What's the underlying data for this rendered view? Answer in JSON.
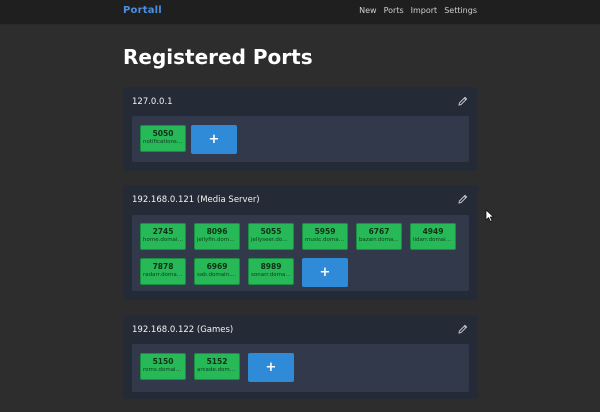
{
  "nav": {
    "brand": "Portall",
    "links": [
      "New",
      "Ports",
      "Import",
      "Settings"
    ]
  },
  "page": {
    "title": "Registered Ports"
  },
  "groups": [
    {
      "title": "127.0.0.1",
      "ports": [
        {
          "number": "5050",
          "domain": "notifications.d..."
        }
      ]
    },
    {
      "title": "192.168.0.121 (Media Server)",
      "ports": [
        {
          "number": "2745",
          "domain": "home.domain...."
        },
        {
          "number": "8096",
          "domain": "jellyfin.domai..."
        },
        {
          "number": "5055",
          "domain": "jellyseer.doma..."
        },
        {
          "number": "5959",
          "domain": "music.domain...."
        },
        {
          "number": "6767",
          "domain": "bazarr.domain...."
        },
        {
          "number": "4949",
          "domain": "lidarr.domain...."
        },
        {
          "number": "7878",
          "domain": "radarr.domain...."
        },
        {
          "number": "6969",
          "domain": "sab.domain.tld"
        },
        {
          "number": "8989",
          "domain": "sonarr.domai..."
        }
      ]
    },
    {
      "title": "192.168.0.122 (Games)",
      "ports": [
        {
          "number": "5150",
          "domain": "roms.domain...."
        },
        {
          "number": "5152",
          "domain": "arcade.domai..."
        }
      ]
    }
  ],
  "add_button_label": "+",
  "icons": {
    "edit": "pencil-icon",
    "cursor": "mouse-cursor-icon"
  },
  "colors": {
    "accent": "#4a90e2",
    "port": "#27b857",
    "add": "#2f8ad8"
  }
}
